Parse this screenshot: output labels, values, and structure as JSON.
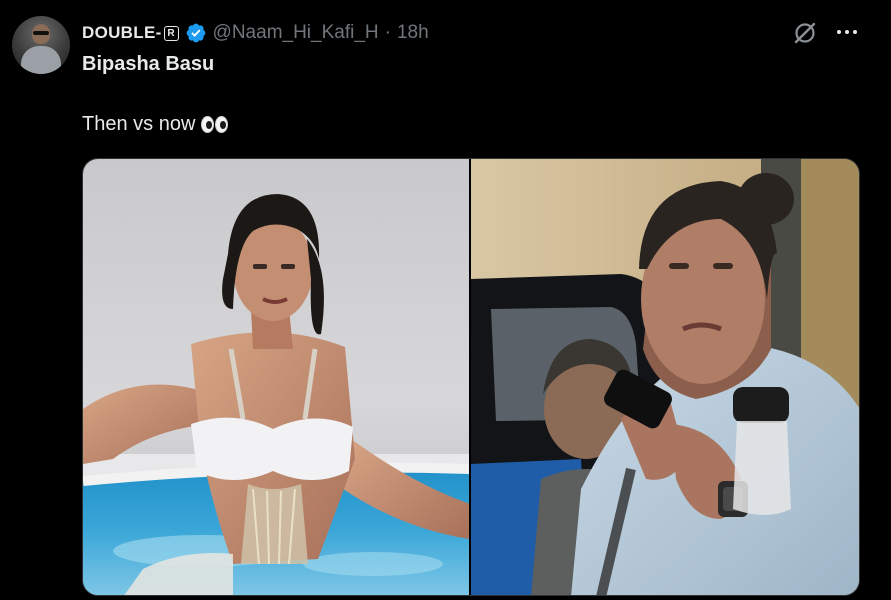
{
  "tweet": {
    "display_name": "DOUBLE-",
    "name_badge": "R",
    "verified": true,
    "handle": "@Naam_Hi_Kafi_H",
    "separator": "·",
    "time": "18h",
    "text_line1": "Bipasha Basu",
    "text_line2": "Then vs now",
    "emoji": "eyes-emoji"
  },
  "media": {
    "count": 2,
    "images": [
      {
        "icon": "photo-woman-in-pool-then"
      },
      {
        "icon": "photo-woman-with-phone-now"
      }
    ]
  },
  "icons": {
    "verified": "verified-badge-icon",
    "grok": "grok-icon",
    "more": "more-options-icon"
  },
  "colors": {
    "background": "#000000",
    "text_primary": "#e7e9ea",
    "text_secondary": "#71767b",
    "verified_blue": "#1d9bf0",
    "border": "#2f3336"
  }
}
